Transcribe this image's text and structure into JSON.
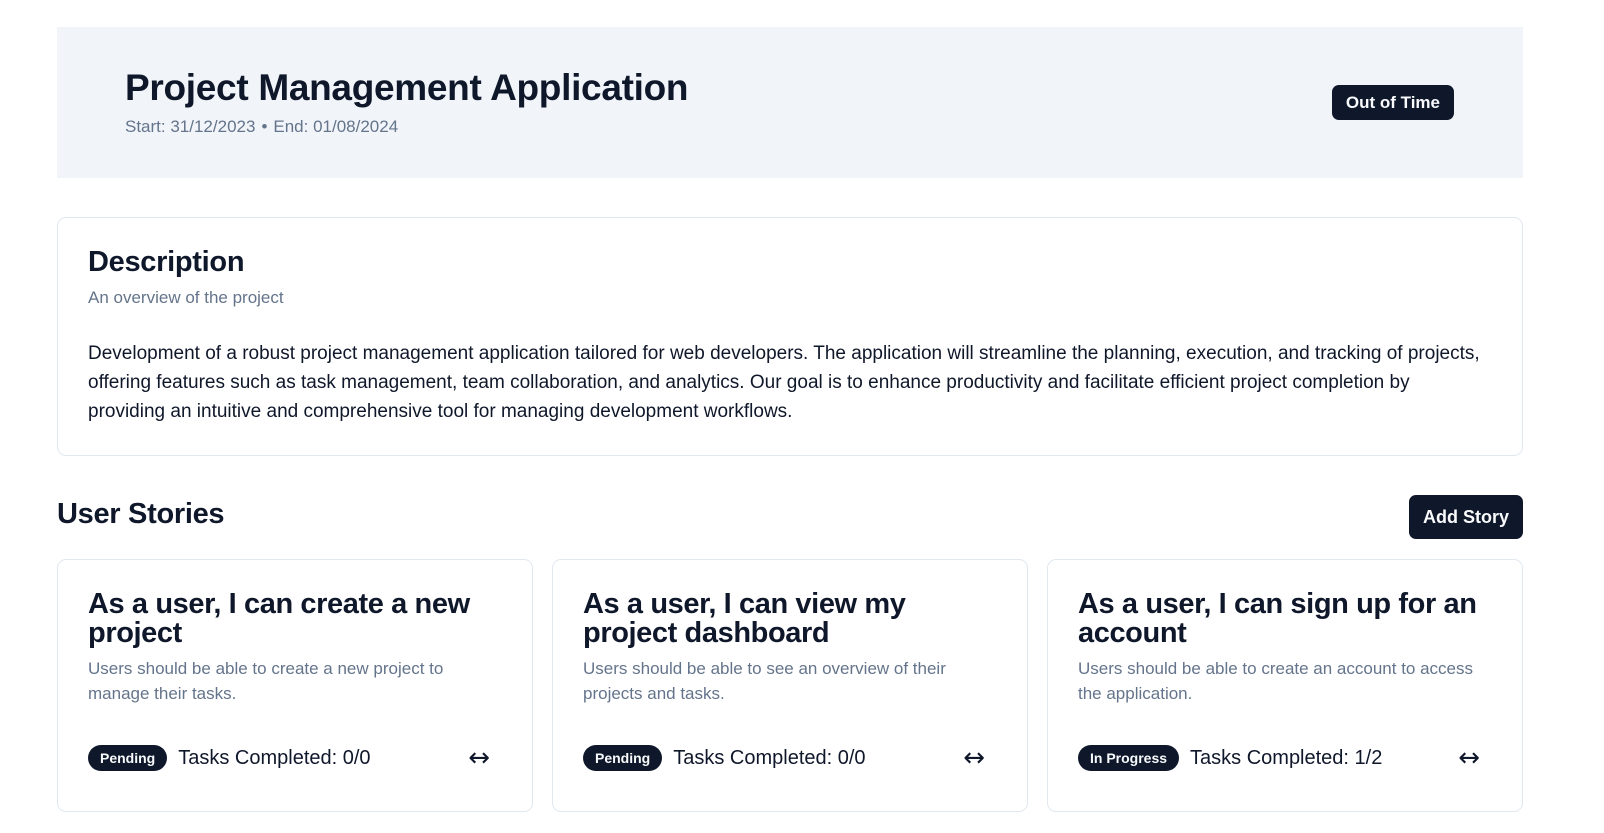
{
  "project": {
    "title": "Project Management Application",
    "start_label": "Start: 31/12/2023",
    "separator": "•",
    "end_label": "End: 01/08/2024",
    "status": "Out of Time"
  },
  "description": {
    "title": "Description",
    "subtitle": "An overview of the project",
    "body": "Development of a robust project management application tailored for web developers. The application will streamline the planning, execution, and tracking of projects, offering features such as task management, team collaboration, and analytics. Our goal is to enhance productivity and facilitate efficient project completion by providing an intuitive and comprehensive tool for managing development workflows."
  },
  "stories": {
    "title": "User Stories",
    "add_label": "Add Story",
    "expand_icon": "↔",
    "items": [
      {
        "title": "As a user, I can create a new project",
        "description": "Users should be able to create a new project to manage their tasks.",
        "status": "Pending",
        "tasks": "Tasks Completed: 0/0"
      },
      {
        "title": "As a user, I can view my project dashboard",
        "description": "Users should be able to see an overview of their projects and tasks.",
        "status": "Pending",
        "tasks": "Tasks Completed: 0/0"
      },
      {
        "title": "As a user, I can sign up for an account",
        "description": "Users should be able to create an account to access the application.",
        "status": "In Progress",
        "tasks": "Tasks Completed: 1/2"
      }
    ]
  },
  "colors": {
    "primary": "#0f172a",
    "muted_text": "#64748b",
    "header_bg": "#f1f5f9",
    "border": "#e2e8f0"
  }
}
